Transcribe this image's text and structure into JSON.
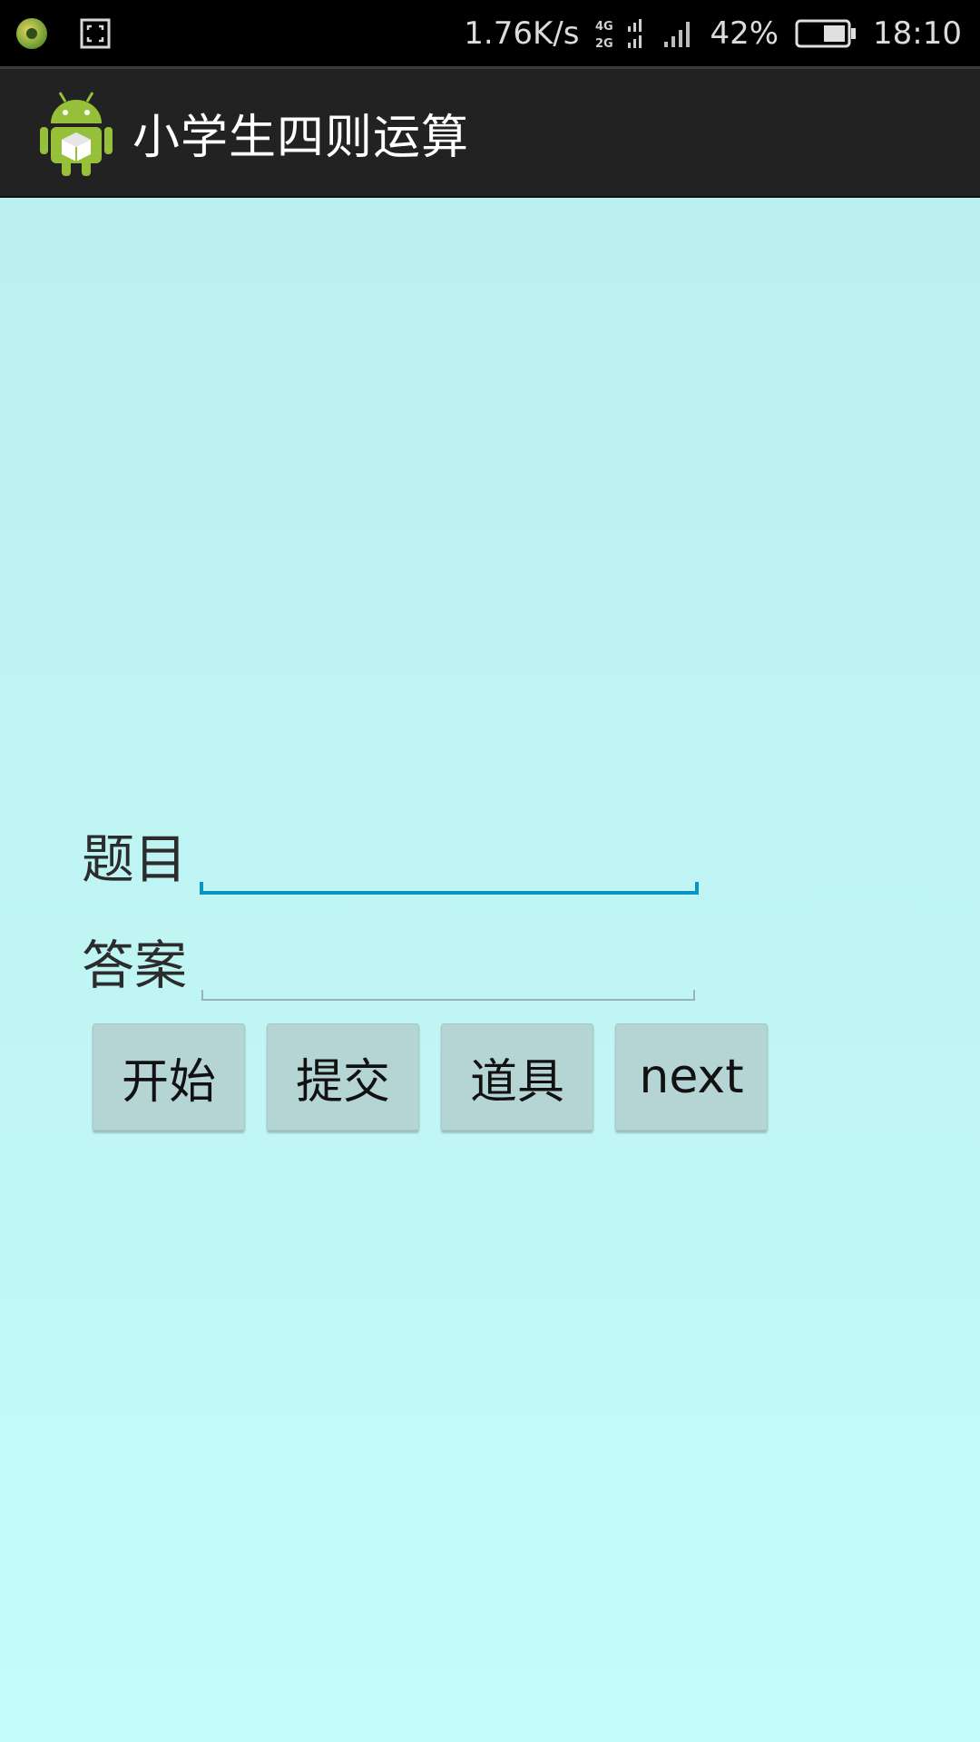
{
  "status_bar": {
    "net_speed": "1.76K/s",
    "battery": "42%",
    "time": "18:10",
    "icons": [
      "app-notification-icon",
      "screenshot-icon",
      "network-4g-2g-icon",
      "signal-icon",
      "battery-icon"
    ]
  },
  "action_bar": {
    "title": "小学生四则运算",
    "logo_icon": "android-app-icon"
  },
  "form": {
    "question_label": "题目",
    "question_value": "",
    "answer_label": "答案",
    "answer_value": ""
  },
  "buttons": {
    "start": "开始",
    "submit": "提交",
    "props": "道具",
    "next": "next"
  },
  "colors": {
    "background": "#c3fcfb",
    "action_bar": "#222222",
    "focus_underline": "#0b93c6",
    "button": "#b5d5d4"
  }
}
